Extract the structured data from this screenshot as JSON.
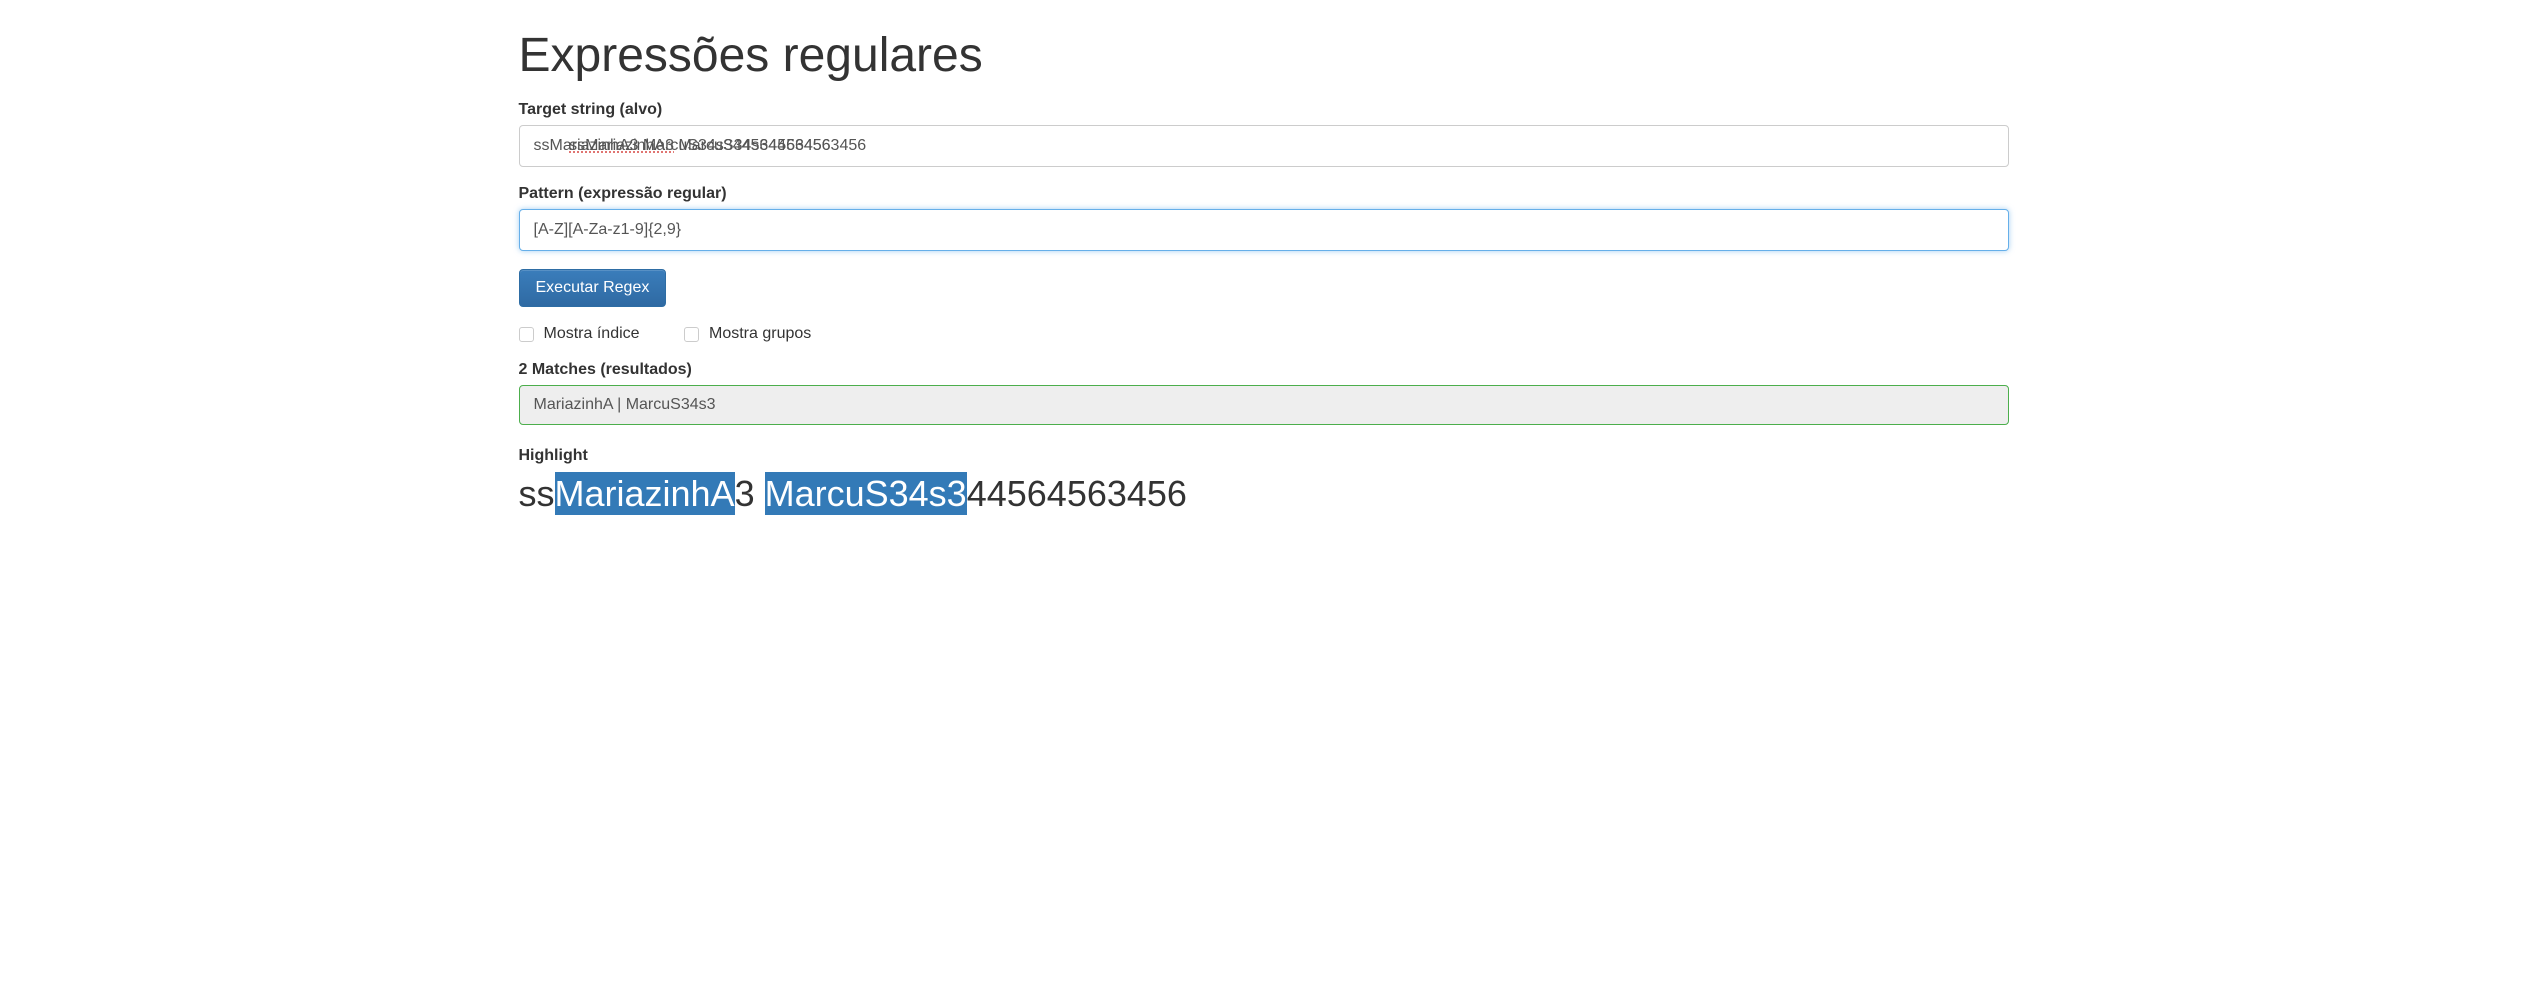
{
  "title": "Expressões regulares",
  "target": {
    "label": "Target string (alvo)",
    "value": "ssMariazinhA3 MarcuS34s344564563456",
    "spell_prefix": "ssMariazinhA3",
    "spell_rest": " MarcuS34s344564563456"
  },
  "pattern": {
    "label": "Pattern (expressão regular)",
    "value": "[A-Z][A-Za-z1-9]{2,9}"
  },
  "execute_button": "Executar Regex",
  "options": {
    "show_index": "Mostra índice",
    "show_groups": "Mostra grupos"
  },
  "results": {
    "label": "2 Matches (resultados)",
    "text": "MariazinhA | MarcuS34s3"
  },
  "highlight": {
    "label": "Highlight",
    "segments": [
      {
        "text": "ss",
        "match": false
      },
      {
        "text": "MariazinhA",
        "match": true
      },
      {
        "text": "3 ",
        "match": false
      },
      {
        "text": "MarcuS34s3",
        "match": true
      },
      {
        "text": "44564563456",
        "match": false
      }
    ]
  }
}
